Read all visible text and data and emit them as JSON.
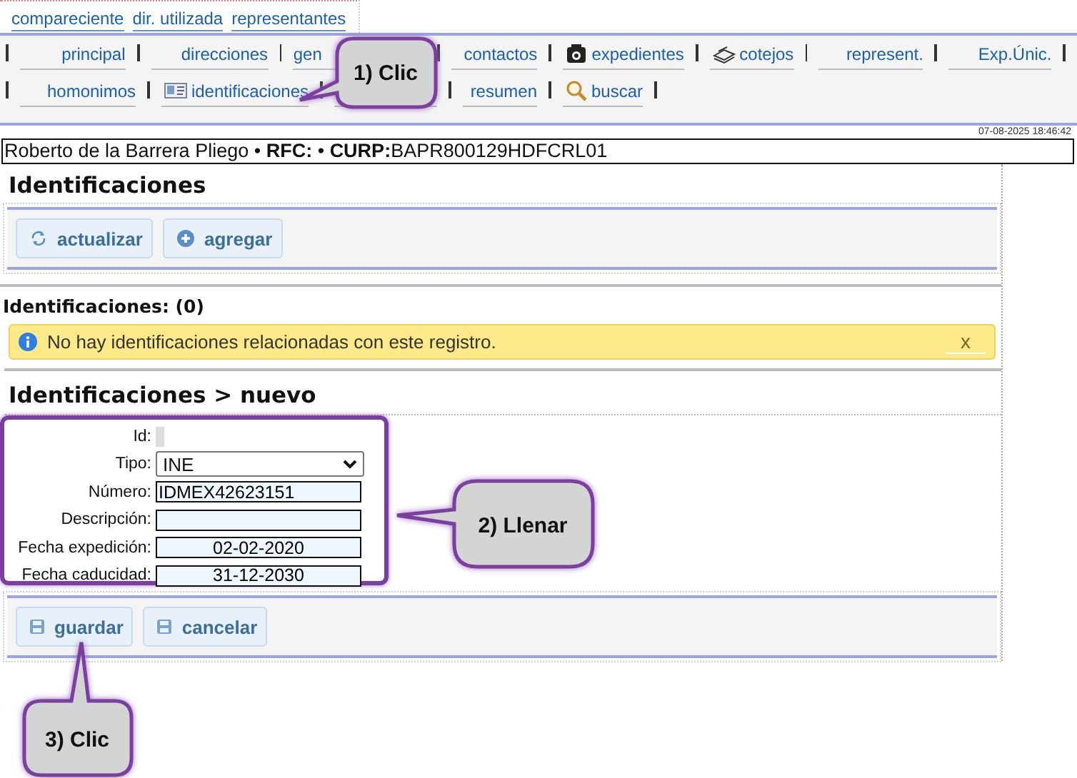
{
  "top_links": [
    {
      "label": "compareciente"
    },
    {
      "label": "dir. utilizada"
    },
    {
      "label": "representantes"
    }
  ],
  "tab_rows": [
    {
      "tabs": [
        {
          "kind": "plain",
          "label": "principal"
        },
        {
          "kind": "plain",
          "label": "direcciones"
        },
        {
          "kind": "plain",
          "label": "gen"
        },
        {
          "kind": "plain",
          "label": "contactos"
        },
        {
          "kind": "icon",
          "label": "expedientes"
        },
        {
          "kind": "icon",
          "label": "cotejos"
        },
        {
          "kind": "plain",
          "label": "represent."
        },
        {
          "kind": "plain",
          "label": "Exp.Únic."
        }
      ]
    },
    {
      "tabs": [
        {
          "kind": "plain",
          "label": "homonimos"
        },
        {
          "kind": "icon",
          "label": "identificaciones"
        },
        {
          "kind": "covered"
        },
        {
          "kind": "plain",
          "label": "resumen"
        },
        {
          "kind": "icon",
          "label": "buscar"
        }
      ]
    }
  ],
  "timestamp": "07-08-2025 18:46:42",
  "record": "Roberto de la Barrera Pliego • **RFC:** • **CURP:**BAPR800129HDFCRL01",
  "section_title": "Identificaciones",
  "toolbar": [
    {
      "label": "actualizar"
    },
    {
      "label": "agregar"
    }
  ],
  "list": {
    "title": "Identificaciones: (0)",
    "alert": {
      "text": "No hay identificaciones relacionadas con este registro.",
      "close": "x"
    }
  },
  "form": {
    "title": "Identificaciones > nuevo",
    "fields": [
      {
        "kind": "readonly",
        "label": "Id:"
      },
      {
        "kind": "select",
        "label": "Tipo:",
        "value": "INE"
      },
      {
        "kind": "text",
        "label": "Número:",
        "value": "IDMEX42623151"
      },
      {
        "kind": "text",
        "label": "Descripción:"
      },
      {
        "kind": "date",
        "label": "Fecha expedición:",
        "value": "02-02-2020"
      },
      {
        "kind": "date",
        "label": "Fecha caducidad:",
        "value": "31-12-2030"
      }
    ],
    "buttons": [
      {
        "label": "guardar"
      },
      {
        "label": "cancelar"
      }
    ]
  },
  "callouts": [
    {
      "text": "1) Clic"
    },
    {
      "text": "2) Llenar"
    },
    {
      "text": "3) Clic"
    }
  ]
}
